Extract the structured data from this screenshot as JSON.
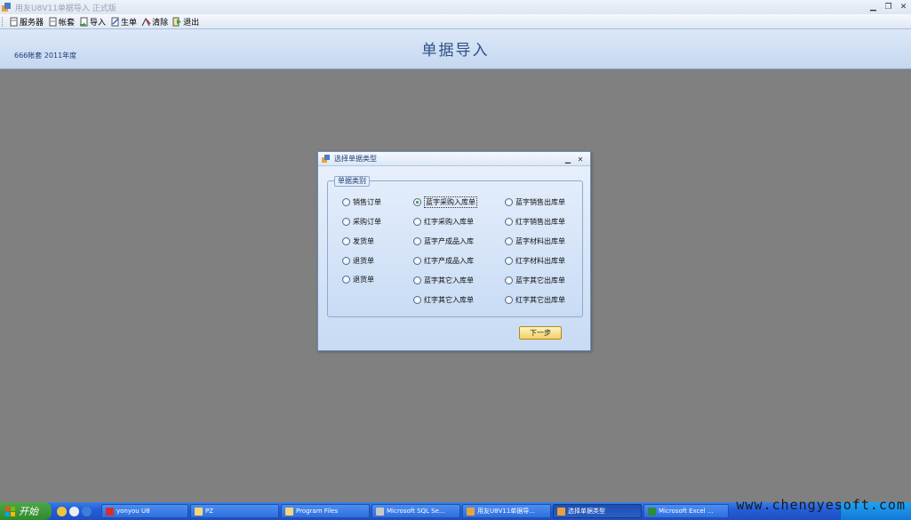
{
  "window": {
    "title": "用友U8V11单据导入 正式版",
    "controls": [
      "minimize-icon",
      "restore-icon",
      "close-icon"
    ]
  },
  "toolbar": {
    "items": [
      {
        "label": "服务器",
        "icon": "server-icon"
      },
      {
        "label": "帐套",
        "icon": "account-icon"
      },
      {
        "label": "导入",
        "icon": "import-icon"
      },
      {
        "label": "生单",
        "icon": "generate-icon"
      },
      {
        "label": "清除",
        "icon": "clear-icon"
      },
      {
        "label": "退出",
        "icon": "exit-icon"
      }
    ]
  },
  "header": {
    "account_info": "666帐套 2011年度",
    "title": "单据导入"
  },
  "dialog": {
    "title": "选择单据类型",
    "group_label": "单据类别",
    "columns": [
      [
        "销售订单",
        "采购订单",
        "发货单",
        "退货单",
        "退货单"
      ],
      [
        "蓝字采购入库单",
        "红字采购入库单",
        "蓝字产成品入库",
        "红字产成品入库",
        "蓝字其它入库单",
        "红字其它入库单"
      ],
      [
        "蓝字销售出库单",
        "红字销售出库单",
        "蓝字材料出库单",
        "红字材料出库单",
        "蓝字其它出库单",
        "红字其它出库单"
      ]
    ],
    "selected": "蓝字采购入库单",
    "next_button": "下一步"
  },
  "taskbar": {
    "start_label": "开始",
    "tasks": [
      {
        "label": "yonyou U8",
        "active": false
      },
      {
        "label": "PZ",
        "active": false
      },
      {
        "label": "Program Files",
        "active": false
      },
      {
        "label": "Microsoft SQL Se...",
        "active": false
      },
      {
        "label": "用友U8V11单据导...",
        "active": false
      },
      {
        "label": "选择单据类型",
        "active": true
      },
      {
        "label": "Microsoft Excel ...",
        "active": false
      }
    ],
    "watermark": "www.chengyesoft.com"
  },
  "colors": {
    "workarea": "#808080",
    "header_title": "#2d4f86",
    "taskbar": "#245edb",
    "start_button": "#2f8a2c",
    "radio_selected_dot": "#2e9e2e"
  }
}
